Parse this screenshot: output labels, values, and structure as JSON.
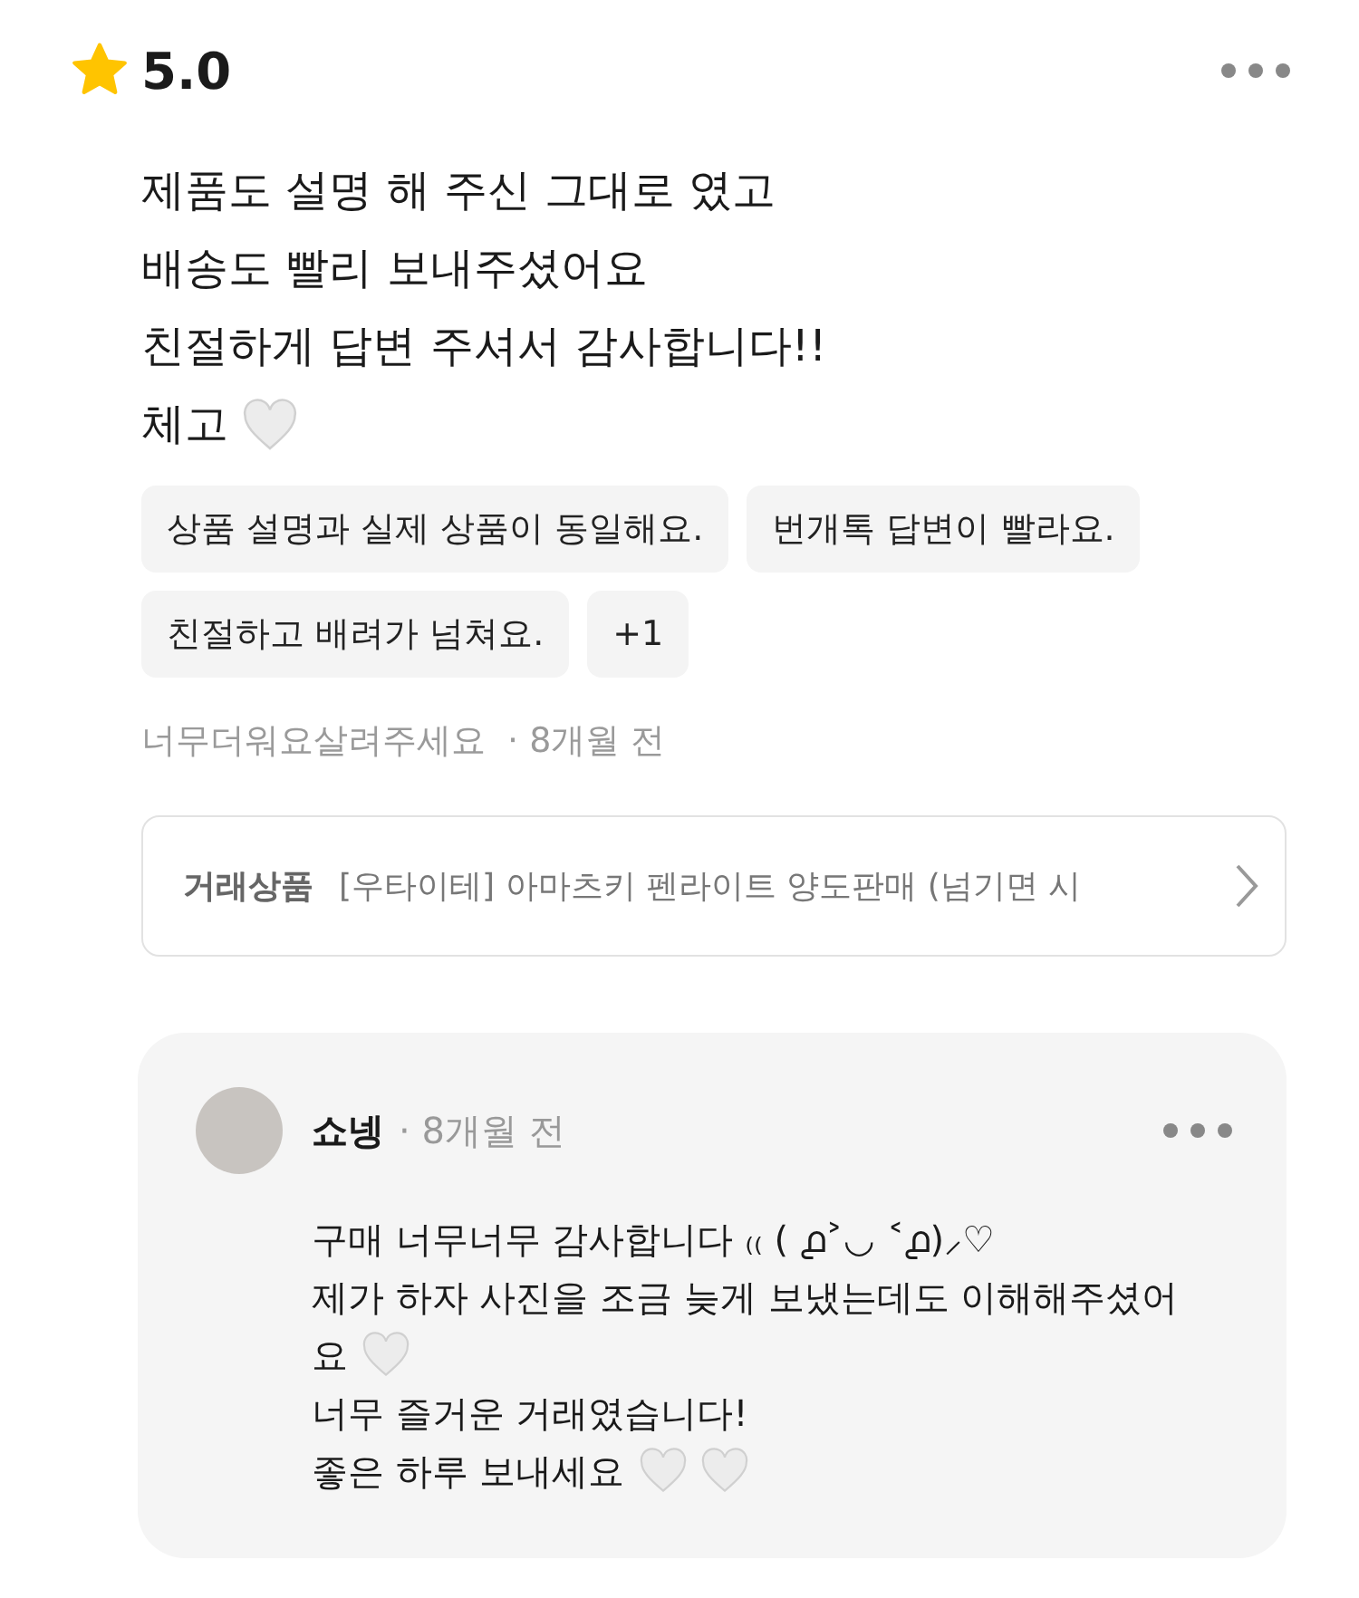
{
  "rating": {
    "score": "5.0"
  },
  "review": {
    "lines": [
      {
        "text": "제품도 설명 해 주신 그대로 였고",
        "kind": "plain"
      },
      {
        "text": "배송도 빨리 보내주셨어요",
        "kind": "plain"
      },
      {
        "text": "친절하게 답변 주셔서 감사합니다!!",
        "kind": "plain"
      },
      {
        "text": "체고",
        "kind": "heart"
      }
    ]
  },
  "tags": [
    "상품 설명과 실제 상품이 동일해요.",
    "번개톡 답변이 빨라요.",
    "친절하고 배려가 넘쳐요.",
    "+1"
  ],
  "meta": {
    "author": "너무더워요살려주세요",
    "time": "· 8개월 전"
  },
  "product": {
    "label": "거래상품",
    "title": "[우타이테] 아마츠키 펜라이트 양도판매 (넘기면 시"
  },
  "reply": {
    "author": "쇼넹",
    "time": "· 8개월 전",
    "lines": [
      {
        "text": "구매 너무너무 감사합니다 ₍₍ ( ൧˃◡ ˂൧)⸝♡",
        "kind": "plain"
      },
      {
        "text": "제가 하자 사진을 조금 늦게 보냈는데도 이해해주셨어",
        "kind": "plain"
      },
      {
        "text": "요",
        "kind": "heart"
      },
      {
        "text": "너무 즐거운 거래였습니다!",
        "kind": "plain"
      },
      {
        "text": "좋은 하루 보내세요",
        "kind": "double_heart"
      }
    ]
  }
}
